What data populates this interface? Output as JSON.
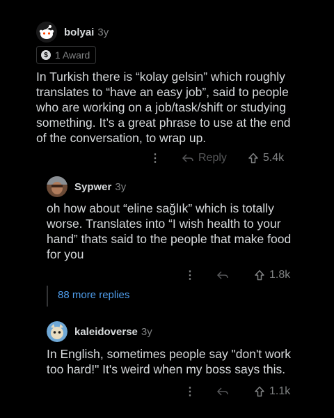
{
  "comments": [
    {
      "username": "bolyai",
      "age": "3y",
      "award": "1 Award",
      "body": "In Turkish there is “kolay gelsin” which roughly translates to “have an easy job”, said to people who are working on a job/task/shift or studying something. It’s a great phrase to use at the end of the conversation, to wrap up.",
      "reply_label": "Reply",
      "votes": "5.4k"
    },
    {
      "username": "Sypwer",
      "age": "3y",
      "body": "oh how about “eline sağlık” which is totally worse. Translates into “I wish health to your hand” thats said to the people that make food for you",
      "votes": "1.8k"
    },
    {
      "username": "kaleidoverse",
      "age": "3y",
      "body": "In English, sometimes people say \"don't work too hard!\" It's weird when my boss says this.",
      "votes": "1.1k"
    }
  ],
  "more_replies": "88 more replies",
  "colors": {
    "background": "#000000",
    "text": "#d7dadc",
    "muted": "#818384",
    "link": "#4f9eed"
  },
  "icons": [
    "snoo-avatar-icon",
    "award-coin-icon",
    "more-options-icon",
    "reply-icon",
    "upvote-icon"
  ]
}
